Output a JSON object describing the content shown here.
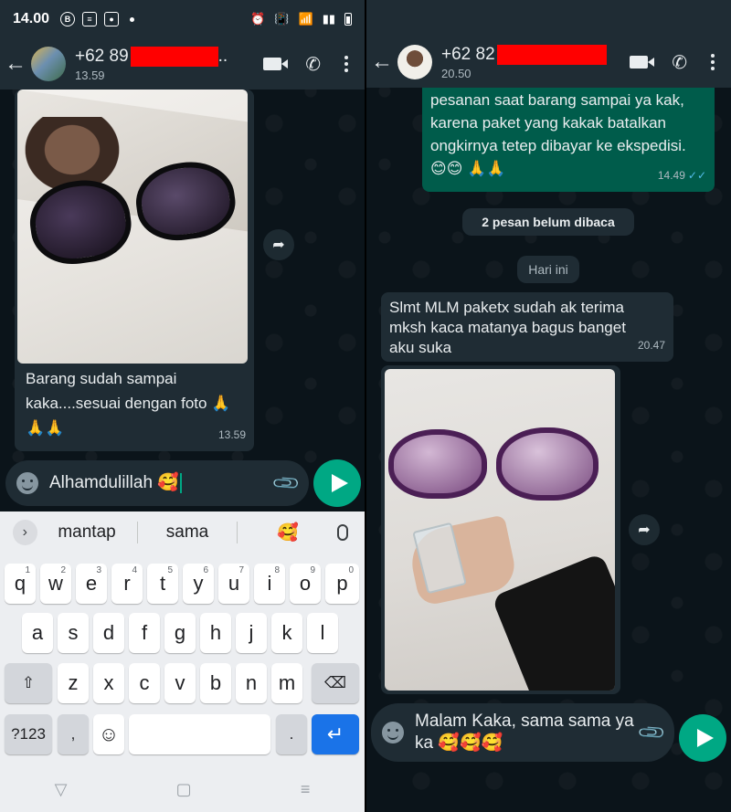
{
  "status_bar": {
    "time": "14.00",
    "icons": [
      "b-icon",
      "notes-icon",
      "record-icon",
      "alarm-icon",
      "vibrate-icon",
      "wifi-icon",
      "signal-icon",
      "battery-icon"
    ]
  },
  "left_chat": {
    "header": {
      "number_prefix": "+62 89",
      "number_suffix": "..",
      "subtitle": "13.59"
    },
    "message_in": {
      "caption": "Barang sudah sampai kaka....sesuai dengan foto 🙏 🙏🙏",
      "time": "13.59"
    },
    "input": {
      "value": "Alhamdulillah 🥰"
    },
    "keyboard": {
      "suggestions": [
        "mantap",
        "sama",
        "🥰"
      ],
      "row1": [
        "q",
        "w",
        "e",
        "r",
        "t",
        "y",
        "u",
        "i",
        "o",
        "p"
      ],
      "row1_nums": [
        "1",
        "2",
        "3",
        "4",
        "5",
        "6",
        "7",
        "8",
        "9",
        "0"
      ],
      "row2": [
        "a",
        "s",
        "d",
        "f",
        "g",
        "h",
        "j",
        "k",
        "l"
      ],
      "row3": [
        "z",
        "x",
        "c",
        "v",
        "b",
        "n",
        "m"
      ],
      "symbols_key": "?123",
      "comma_key": ",",
      "period_key": "."
    }
  },
  "right_chat": {
    "header": {
      "number_prefix": "+62 82",
      "subtitle": "20.50"
    },
    "message_out": {
      "text": "Mohon untuk tidak membatalkan pesanan saat barang sampai ya kak, karena paket yang kakak batalkan ongkirnya tetep dibayar ke ekspedisi. 😊😊 🙏🙏",
      "time": "14.49"
    },
    "unread_label": "2 pesan belum dibaca",
    "date_label": "Hari ini",
    "message_in": {
      "text": "Slmt MLM paketx sudah ak terima mksh kaca matanya bagus banget aku suka",
      "time": "20.47"
    },
    "input": {
      "value": "Malam Kaka, sama sama ya ka 🥰🥰🥰"
    }
  },
  "colors": {
    "chat_bg": "#0b141a",
    "bar_bg": "#1f2c34",
    "outgoing": "#005c4b",
    "accent": "#00a884",
    "redaction": "#ff0000"
  }
}
